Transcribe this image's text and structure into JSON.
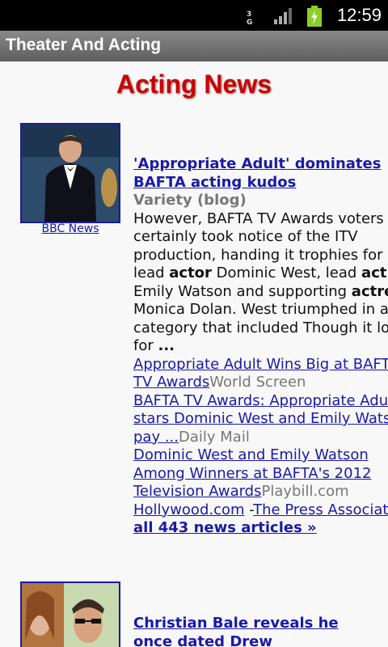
{
  "status": {
    "network": "3G",
    "time": "12:59"
  },
  "app": {
    "title": "Theater And Acting"
  },
  "page": {
    "heading": "Acting News"
  },
  "article1": {
    "thumb_caption": "BBC News",
    "headline_lines": [
      "'Appropriate Adult' dominates",
      "BAFTA acting kudos"
    ],
    "source": "Variety (blog)",
    "snippet_lines": [
      [
        "However, BAFTA TV Awards voters"
      ],
      [
        "certainly took notice of the ITV"
      ],
      [
        "production, handing it trophies for"
      ],
      [
        "lead ",
        "actor",
        " Dominic West, lead ",
        "actre"
      ],
      [
        "Emily Watson and supporting ",
        "actres"
      ],
      [
        "Monica Dolan. West triumphed in a"
      ],
      [
        "category that included Though it los"
      ],
      [
        "for ",
        "..."
      ]
    ],
    "related": [
      {
        "lines": [
          "Appropriate Adult Wins Big at BAFTA",
          "TV Awards"
        ],
        "source": "World Screen"
      },
      {
        "lines": [
          "BAFTA TV Awards: Appropriate Adul",
          "stars Dominic West and Emily Watso",
          "pay ..."
        ],
        "source": "Daily Mail"
      },
      {
        "lines": [
          "Dominic West and Emily Watson",
          "Among Winners at BAFTA's 2012",
          "Television Awards"
        ],
        "source": "Playbill.com"
      }
    ],
    "extra_link_1": "Hollywood.com",
    "extra_sep": " -",
    "extra_link_2": "The Press Associati",
    "all_articles": "all 443 news articles »"
  },
  "article2": {
    "headline_lines": [
      "Christian Bale reveals he",
      "once dated Drew"
    ]
  }
}
